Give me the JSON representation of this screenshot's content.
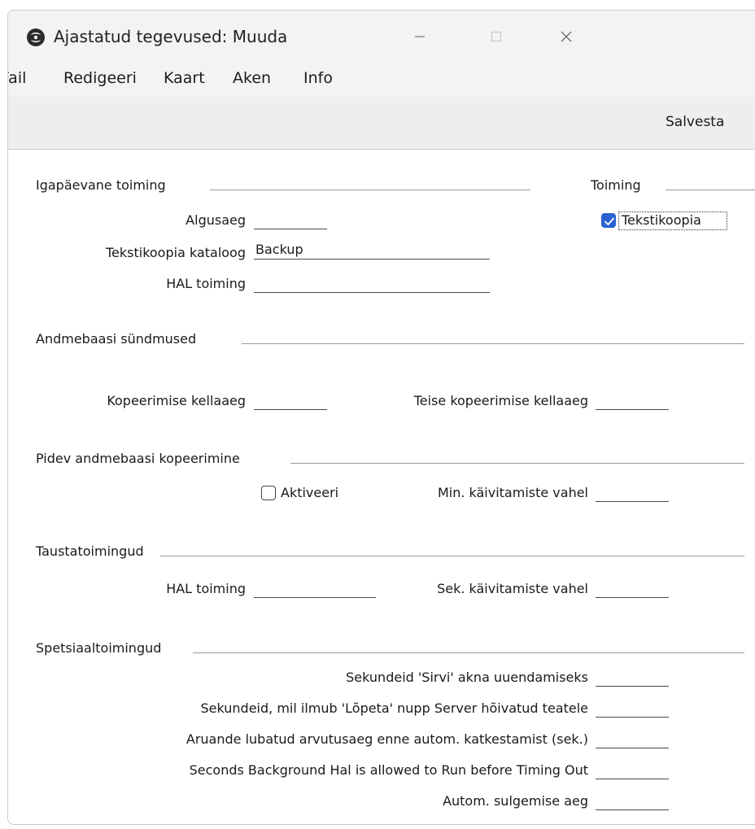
{
  "window": {
    "title": "Ajastatud tegevused: Muuda",
    "controls": {
      "minimize": "minimize-icon",
      "maximize": "maximize-icon",
      "close": "close-icon"
    }
  },
  "menubar": {
    "items": [
      "Fail",
      "Redigeeri",
      "Kaart",
      "Aken",
      "Info"
    ]
  },
  "toolbar": {
    "save_label": "Salvesta"
  },
  "daily": {
    "section_title": "Igapäevane toiming",
    "start_time_label": "Algusaeg",
    "start_time_value": "",
    "backup_folder_label": "Tekstikoopia kataloog",
    "backup_folder_value": "Backup",
    "hal_label": "HAL toiming",
    "hal_value": ""
  },
  "action": {
    "section_title": "Toiming",
    "text_backup_label": "Tekstikoopia",
    "text_backup_checked": true
  },
  "db_events": {
    "section_title": "Andmebaasi sündmused",
    "copy_time_label": "Kopeerimise kellaaeg",
    "copy_time_value": "",
    "second_copy_time_label": "Teise kopeerimise kellaaeg",
    "second_copy_time_value": ""
  },
  "continuous": {
    "section_title": "Pidev andmebaasi kopeerimine",
    "activate_label": "Aktiveeri",
    "activate_checked": false,
    "min_between_label": "Min. käivitamiste vahel",
    "min_between_value": ""
  },
  "background": {
    "section_title": "Taustatoimingud",
    "hal_label": "HAL toiming",
    "hal_value": "",
    "sec_between_label": "Sek. käivitamiste vahel",
    "sec_between_value": ""
  },
  "special": {
    "section_title": "Spetsiaaltoimingud",
    "rows": [
      {
        "label": "Sekundeid 'Sirvi' akna uuendamiseks",
        "value": ""
      },
      {
        "label": "Sekundeid, mil ilmub 'Lõpeta' nupp Server hõivatud teatele",
        "value": ""
      },
      {
        "label": "Aruande lubatud arvutusaeg enne autom. katkestamist (sek.)",
        "value": ""
      },
      {
        "label": "Seconds Background Hal is allowed to Run before Timing Out",
        "value": ""
      },
      {
        "label": "Autom. sulgemise aeg",
        "value": ""
      }
    ]
  },
  "colors": {
    "accent": "#2a63d0",
    "titlebar": "#f3f3f3",
    "toolbar": "#eeeef0"
  }
}
